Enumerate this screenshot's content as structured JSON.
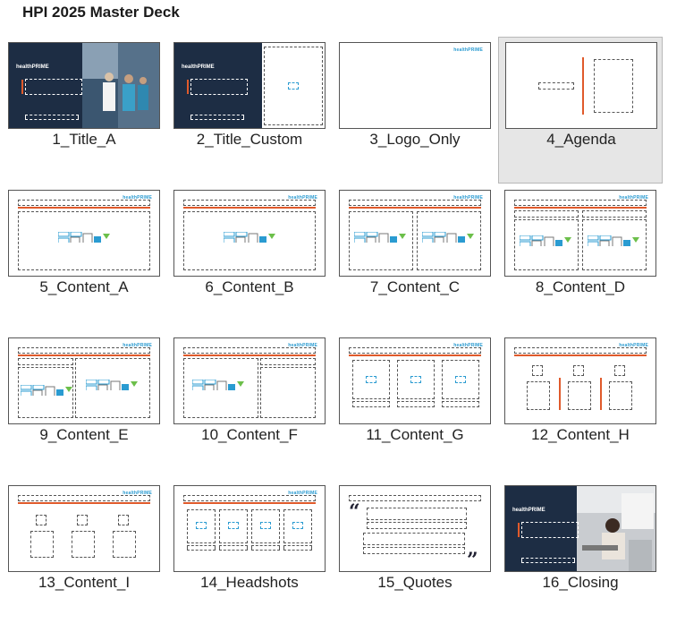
{
  "deck": {
    "title": "HPI 2025 Master Deck"
  },
  "brand": {
    "logo_text": "healthPRIME",
    "accent": "#e05a2b",
    "navy": "#1d2d44",
    "logo_blue": "#2a9bd1"
  },
  "layouts": [
    {
      "label": "1_Title_A",
      "selected": false
    },
    {
      "label": "2_Title_Custom",
      "selected": false
    },
    {
      "label": "3_Logo_Only",
      "selected": false
    },
    {
      "label": "4_Agenda",
      "selected": true
    },
    {
      "label": "5_Content_A",
      "selected": false
    },
    {
      "label": "6_Content_B",
      "selected": false
    },
    {
      "label": "7_Content_C",
      "selected": false
    },
    {
      "label": "8_Content_D",
      "selected": false
    },
    {
      "label": "9_Content_E",
      "selected": false
    },
    {
      "label": "10_Content_F",
      "selected": false
    },
    {
      "label": "11_Content_G",
      "selected": false
    },
    {
      "label": "12_Content_H",
      "selected": false
    },
    {
      "label": "13_Content_I",
      "selected": false
    },
    {
      "label": "14_Headshots",
      "selected": false
    },
    {
      "label": "15_Quotes",
      "selected": false
    },
    {
      "label": "16_Closing",
      "selected": false
    }
  ]
}
